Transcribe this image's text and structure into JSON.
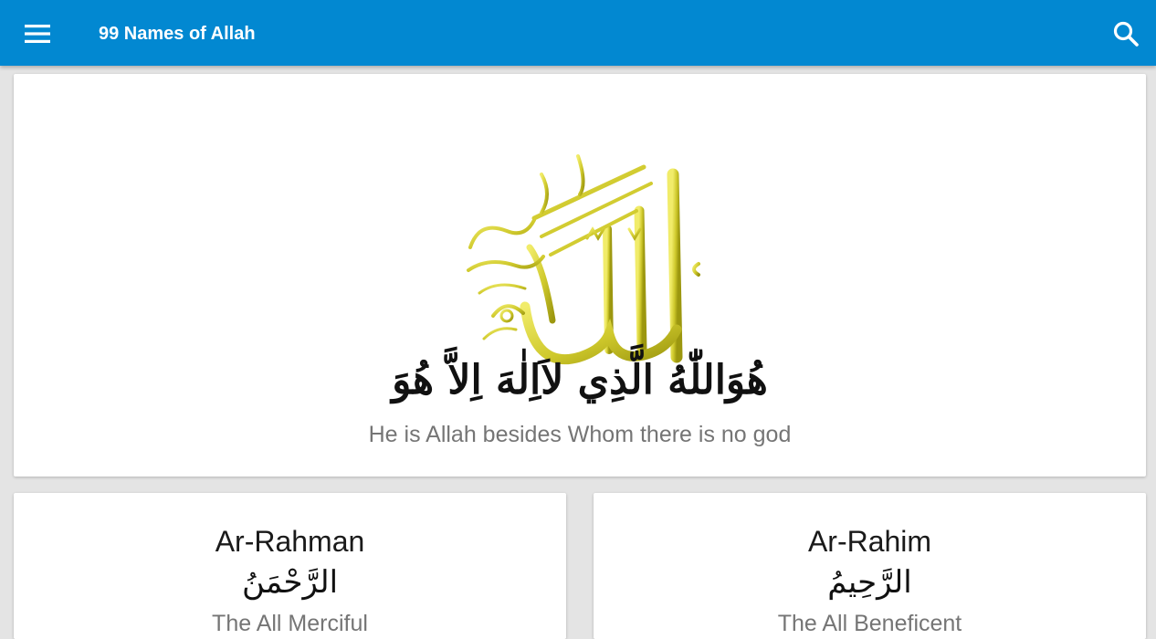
{
  "appbar": {
    "title": "99 Names of Allah",
    "menu_icon": "hamburger-menu-icon",
    "search_icon": "search-icon",
    "background_color": "#0288d1"
  },
  "hero": {
    "calligraphy_image": "allah-calligraphy-icon",
    "calligraphy_color": "#c9c425",
    "verse_arabic": "هُوَاللّٰهُ الَّذِي لاَاِلٰهَ اِلاَّ هُوَ",
    "translation": "He is Allah besides Whom there is no god"
  },
  "names": [
    {
      "transliteration": "Ar-Rahman",
      "arabic": "الرَّحْمَنُ",
      "meaning": "The All Merciful"
    },
    {
      "transliteration": "Ar-Rahim",
      "arabic": "الرَّحِيمُ",
      "meaning": "The All Beneficent"
    }
  ]
}
